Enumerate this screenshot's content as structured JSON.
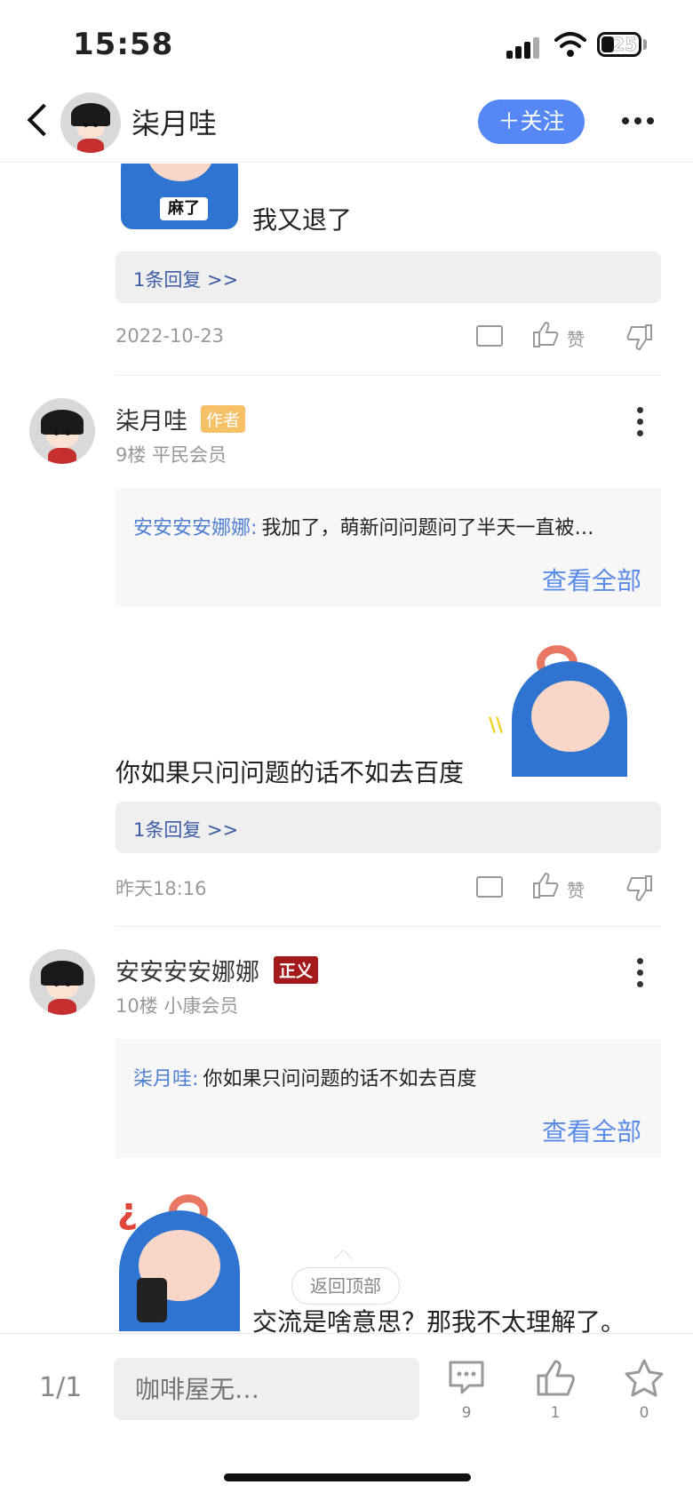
{
  "status_bar": {
    "time": "15:58",
    "battery": "25"
  },
  "header": {
    "name": "柒月哇",
    "follow_label": "＋关注"
  },
  "post_a": {
    "sticker_text": "麻了",
    "text": "我又退了",
    "reply_link": "1条回复 >>",
    "date": "2022-10-23",
    "like_label": "赞"
  },
  "post_b": {
    "username": "柒月哇",
    "badge": "作者",
    "meta": "9楼  平民会员",
    "quote_name": "安安安安娜娜:",
    "quote_text": "我加了，萌新问问题问了半天一直被…",
    "see_all": "查看全部",
    "text": "你如果只问问题的话不如去百度",
    "reply_link": "1条回复 >>",
    "date": "昨天18:16",
    "like_label": "赞"
  },
  "post_c": {
    "username": "安安安安娜娜",
    "badge": "正义",
    "meta": "10楼  小康会员",
    "quote_name": "柒月哇:",
    "quote_text": "你如果只问问题的话不如去百度",
    "see_all": "查看全部",
    "text": "交流是啥意思？那我不太理解了。"
  },
  "back_to_top": "返回顶部",
  "bottom_bar": {
    "page": "1/1",
    "input_placeholder": "咖啡屋无…",
    "comment_count": "9",
    "like_count": "1",
    "star_count": "0"
  },
  "icons": [
    "back-icon",
    "more-icon",
    "comment-icon",
    "like-icon",
    "dislike-icon",
    "star-icon"
  ]
}
